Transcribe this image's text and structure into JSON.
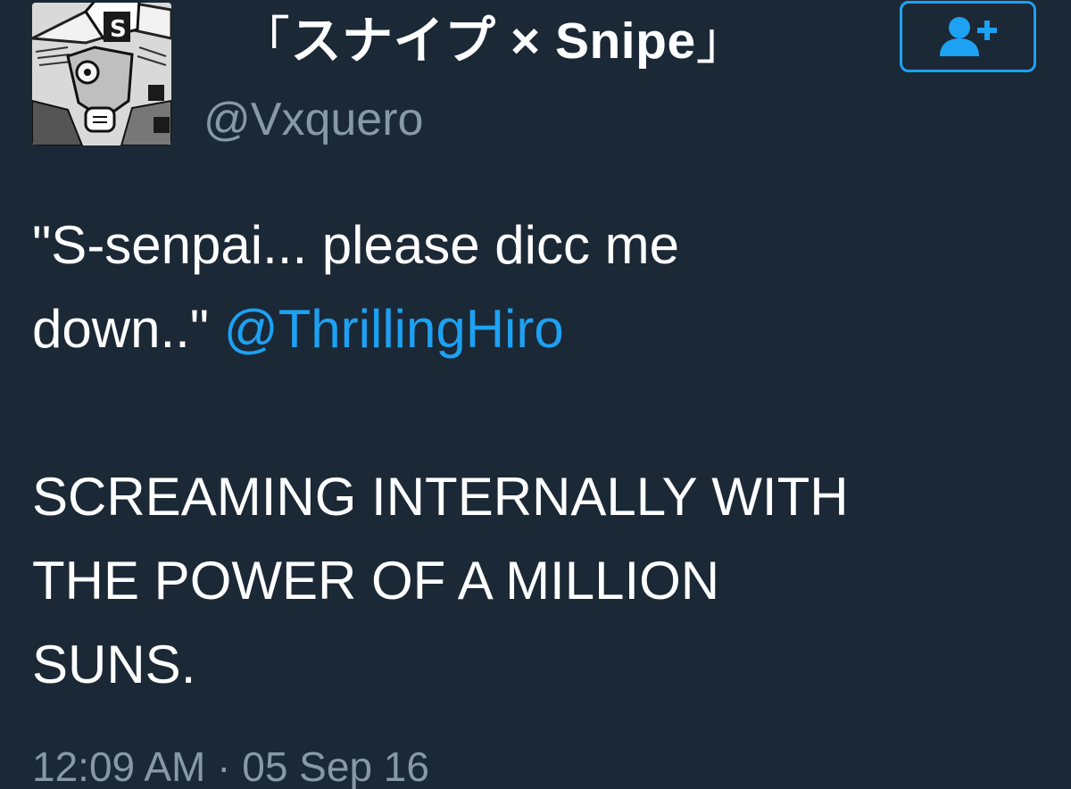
{
  "user": {
    "name_open_bracket": "「",
    "name_text": "スナイプ × Snipe",
    "name_close_bracket": "」",
    "handle": "@Vxquero",
    "avatar_icon": "manga-avatar-icon"
  },
  "follow_button": {
    "icon": "add-user-icon"
  },
  "tweet": {
    "line1": "\"S-senpai... please dicc me",
    "line2_prefix": "down..\" ",
    "mention": "@ThrillingHiro",
    "line3": "SCREAMING INTERNALLY WITH",
    "line4": "THE POWER OF A MILLION",
    "line5": "SUNS.",
    "timestamp": "12:09 AM · 05 Sep 16"
  },
  "colors": {
    "background": "#1b2836",
    "text": "#ffffff",
    "muted": "#8899a6",
    "accent": "#1da1f2"
  }
}
